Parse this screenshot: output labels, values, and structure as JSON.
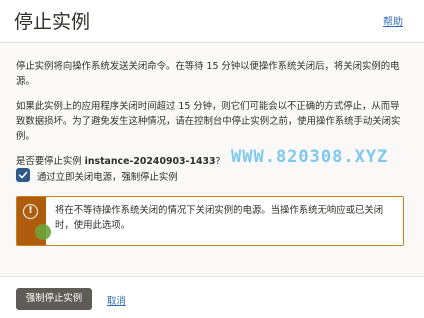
{
  "header": {
    "title": "停止实例",
    "help_label": "帮助"
  },
  "body": {
    "paragraph1": "停止实例将向操作系统发送关闭命令。在等待 15 分钟以便操作系统关闭后，将关闭实例的电源。",
    "paragraph2": "如果此实例上的应用程序关闭时间超过 15 分钟，则它们可能会以不正确的方式停止，从而导致数据损坏。为了避免发生这种情况，请在控制台中停止实例之前，使用操作系统手动关闭实例。",
    "confirm_prefix": "是否要停止实例 ",
    "instance_name": "instance-20240903-1433",
    "confirm_suffix": "?",
    "checkbox": {
      "label": "通过立即关闭电源，强制停止实例",
      "checked": true
    },
    "warning": {
      "icon": "exclamation-circle-icon",
      "text": "将在不等待操作系统关闭的情况下关闭实例的电源。当操作系统无响应或已关闭时，使用此选项。"
    },
    "watermark": "WWW.820308.XYZ"
  },
  "footer": {
    "force_stop_label": "强制停止实例",
    "cancel_label": "取消"
  },
  "colors": {
    "primary_button": "#5f5b56",
    "link": "#2e6eb8",
    "checkbox": "#2e5a88",
    "warning_bar": "#b05c0f",
    "warning_border": "#c5841a"
  }
}
